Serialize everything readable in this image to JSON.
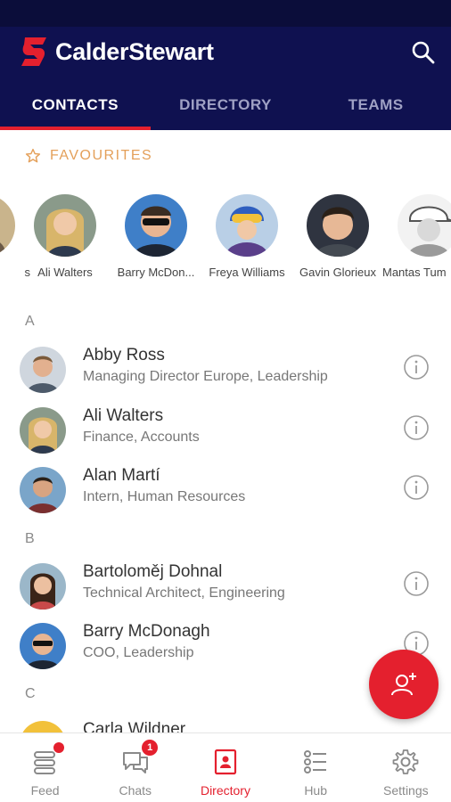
{
  "header": {
    "brand_name": "CalderStewart",
    "search_icon": "search-icon"
  },
  "tabs": [
    {
      "label": "CONTACTS",
      "active": true
    },
    {
      "label": "DIRECTORY",
      "active": false
    },
    {
      "label": "TEAMS",
      "active": false
    }
  ],
  "favourites": {
    "title": "FAVOURITES",
    "items": [
      {
        "name": "s"
      },
      {
        "name": "Ali Walters"
      },
      {
        "name": "Barry McDon..."
      },
      {
        "name": "Freya Williams"
      },
      {
        "name": "Gavin Glorieux"
      },
      {
        "name": "Mantas Tum"
      }
    ]
  },
  "sections": [
    {
      "letter": "A"
    },
    {
      "letter": "B"
    },
    {
      "letter": "C"
    }
  ],
  "contacts": [
    {
      "name": "Abby Ross",
      "role": "Managing Director Europe, Leadership"
    },
    {
      "name": "Ali Walters",
      "role": "Finance, Accounts"
    },
    {
      "name": "Alan Martí",
      "role": "Intern, Human Resources"
    },
    {
      "name": "Bartoloměj Dohnal",
      "role": "Technical Architect, Engineering"
    },
    {
      "name": "Barry McDonagh",
      "role": "COO, Leadership"
    },
    {
      "name": "Carla Wildner",
      "role": ""
    }
  ],
  "bottom_nav": [
    {
      "label": "Feed",
      "icon": "feed-icon",
      "badge": ""
    },
    {
      "label": "Chats",
      "icon": "chats-icon",
      "badge": "1"
    },
    {
      "label": "Directory",
      "icon": "directory-icon",
      "active": true
    },
    {
      "label": "Hub",
      "icon": "hub-icon"
    },
    {
      "label": "Settings",
      "icon": "gear-icon"
    }
  ],
  "colors": {
    "navy": "#0f1150",
    "accent_red": "#e4202e",
    "favourites_orange": "#e4a05a"
  }
}
